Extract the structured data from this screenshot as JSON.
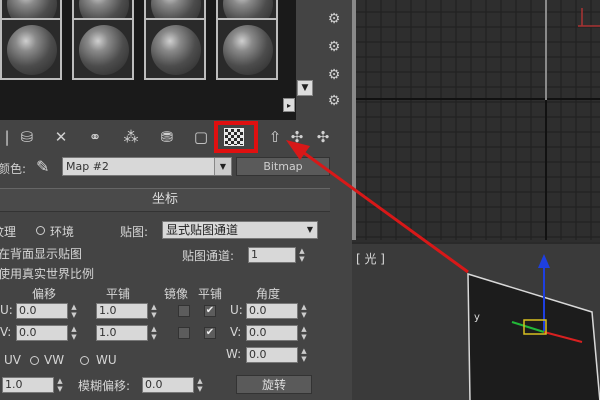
{
  "material_editor": {
    "map_row": {
      "label": "颜色:",
      "map_name": "Map #2",
      "map_type_button": "Bitmap"
    },
    "coordinates": {
      "rollout_title": "坐标",
      "texture_option": "纹理",
      "environ_option": "环境",
      "mapping_label": "贴图:",
      "mapping_value": "显式贴图通道",
      "show_map_on_back": "在背面显示贴图",
      "map_channel_label": "贴图通道:",
      "map_channel_value": "1",
      "real_world_scale": "使用真实世界比例",
      "offset_header": "偏移",
      "tiling_header": "平铺",
      "mirror_header": "镜像",
      "tile_header": "平铺",
      "angle_header": "角度",
      "u_label": "U:",
      "v_label": "V:",
      "w_label": "W:",
      "u_offset": "0.0",
      "v_offset": "0.0",
      "u_tiling": "1.0",
      "v_tiling": "1.0",
      "u_angle": "0.0",
      "v_angle": "0.0",
      "w_angle": "0.0",
      "u_tile_checked": "✔",
      "v_tile_checked": "✔",
      "uv_option": "UV",
      "vw_option": "VW",
      "wu_option": "WU",
      "blur_value": "1.0",
      "blur_offset_label": "模糊偏移:",
      "blur_offset_value": "0.0",
      "rotate_button": "旋转"
    }
  },
  "viewport": {
    "label": "[ 光 ]"
  },
  "colors": {
    "highlight": "#e01010",
    "arrow": "#d81818"
  }
}
